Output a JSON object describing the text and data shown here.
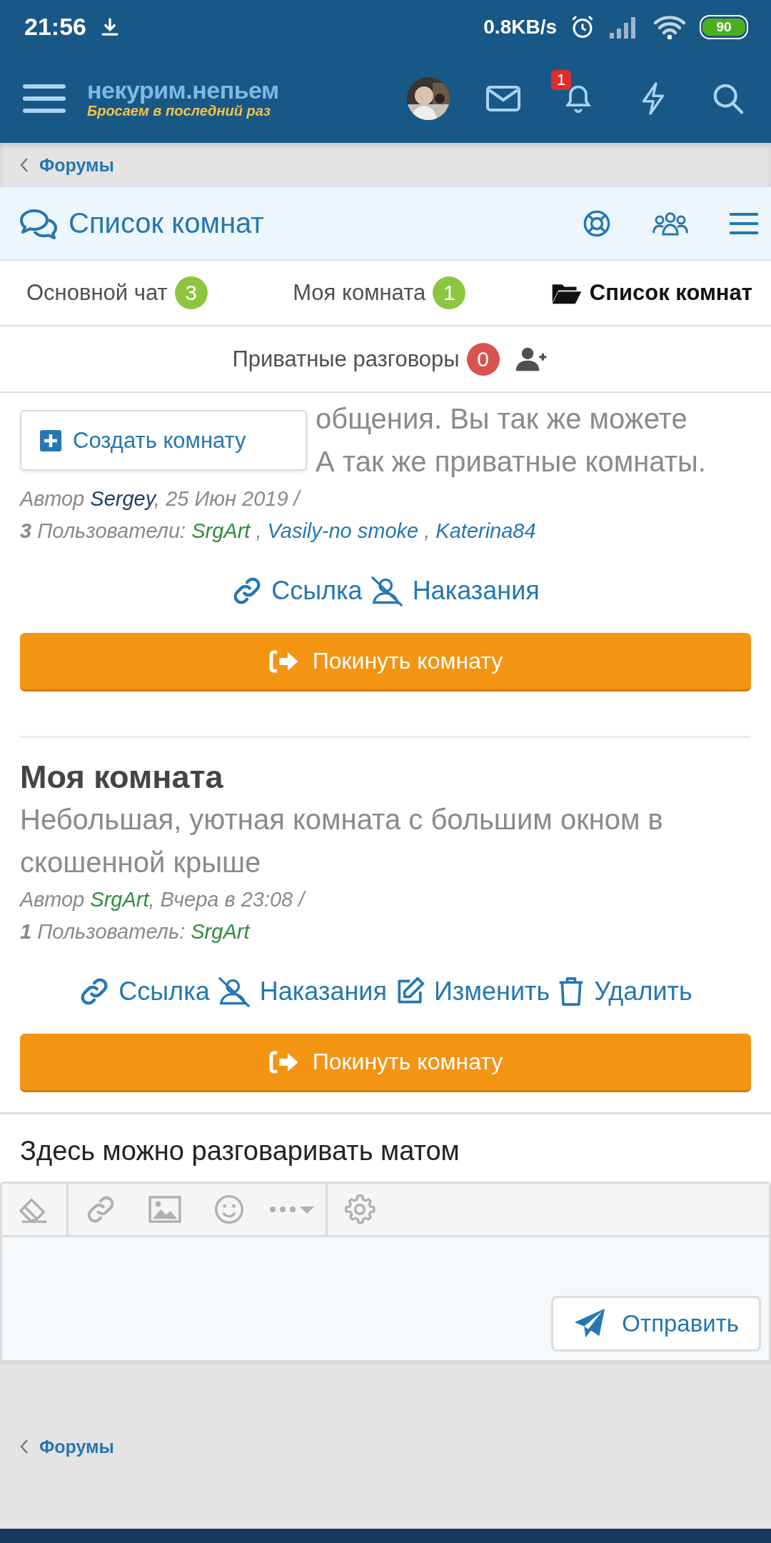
{
  "status_bar": {
    "time": "21:56",
    "speed": "0.8KB/s",
    "battery": "90"
  },
  "header": {
    "logo_title": "некурим.непьем",
    "logo_subtitle": "Бросаем в последний раз",
    "notifications_badge": "1"
  },
  "breadcrumb": {
    "label": "Форумы"
  },
  "page_title": "Список комнат",
  "tabs": [
    {
      "label": "Основной чат",
      "count": "3",
      "color": "#8cc63f",
      "selected": false
    },
    {
      "label": "Моя комната",
      "count": "1",
      "color": "#8cc63f",
      "selected": false
    },
    {
      "label": "Список комнат",
      "selected": true
    },
    {
      "label": "Приватные разговоры",
      "count": "0",
      "color": "#d9534f",
      "selected": false
    }
  ],
  "create_button": "Создать комнату",
  "rooms": [
    {
      "description_lines": [
        "общения. Вы так же можете",
        "А так же приватные комнаты."
      ],
      "author_prefix": "Автор",
      "author": {
        "name": "Sergey",
        "color": "#1d3c5e"
      },
      "date": ", 25 Июн 2019 /",
      "users_label": "**3** Пользователи:",
      "separator": ",",
      "users": [
        {
          "name": "SrgArt",
          "color": "#2e8b3e"
        },
        {
          "name": "Vasily-no smoke",
          "color": "#2577b1"
        },
        {
          "name": "Katerina84",
          "color": "#2577b1"
        }
      ],
      "actions": [
        {
          "kind": "link",
          "label": "Ссылка"
        },
        {
          "kind": "ban",
          "label": "Наказания"
        }
      ],
      "leave_button": "Покинуть комнату"
    },
    {
      "title": "Моя комната",
      "description_lines": [
        "Небольшая, уютная комната с большим окном в",
        "скошенной крыше"
      ],
      "author_prefix": "Автор",
      "author": {
        "name": "SrgArt",
        "color": "#2e8b3e"
      },
      "date": ", Вчера в 23:08 /",
      "users_label": "**1** Пользователь:",
      "users": [
        {
          "name": "SrgArt",
          "color": "#2e8b3e"
        }
      ],
      "actions": [
        {
          "kind": "link",
          "label": "Ссылка"
        },
        {
          "kind": "ban",
          "label": "Наказания"
        },
        {
          "kind": "edit",
          "label": "Изменить"
        },
        {
          "kind": "delete",
          "label": "Удалить"
        }
      ],
      "leave_button": "Покинуть комнату"
    }
  ],
  "note": "Здесь можно разговаривать матом",
  "editor": {
    "send_button": "Отправить"
  },
  "footer_breadcrumb": {
    "label": "Форумы"
  }
}
